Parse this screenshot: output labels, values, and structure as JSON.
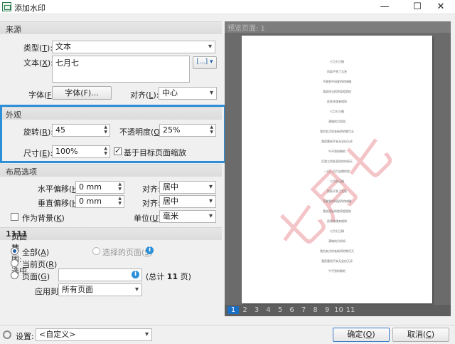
{
  "window": {
    "title": "添加水印",
    "minimize": "—",
    "maximize": "☐",
    "close": "✕"
  },
  "source": {
    "header": "来源",
    "type_label": "类型(",
    "type_key": "T",
    "type_tail": "):",
    "type_value": "文本",
    "text_label": "文本(",
    "text_key": "X",
    "text_tail": "):",
    "text_value": "七月七",
    "insert_icon": "[...]",
    "font_label": "字体(",
    "font_key": "F",
    "font_tail": "):",
    "font_button": "字体(F)...",
    "align_label": "对齐(",
    "align_key": "L",
    "align_tail": "):",
    "align_value": "中心"
  },
  "appearance": {
    "header": "外观",
    "rotation_label": "旋转(",
    "rotation_key": "R",
    "rotation_tail": "):",
    "rotation_value": "45",
    "opacity_label": "不透明度(",
    "opacity_key": "O",
    "opacity_tail": "):",
    "opacity_value": "25%",
    "size_label": "尺寸(",
    "size_key": "E",
    "size_tail": "):",
    "size_value": "100%",
    "scale_checkbox": "基于目标页面缩放",
    "scale_checked": true
  },
  "layout": {
    "header": "布局选项",
    "hoffset_label": "水平偏移(",
    "hoffset_key": "H",
    "hoffset_tail": "):",
    "hoffset_value": "0 mm",
    "halign_label": "对齐:",
    "halign_value": "居中",
    "voffset_label": "垂直偏移(",
    "voffset_key": "H",
    "voffset_tail": "):",
    "voffset_value": "0 mm",
    "valign_label": "对齐:",
    "valign_value": "居中",
    "background_label": "作为背景(",
    "background_key": "K",
    "background_tail": ")",
    "background_checked": false,
    "unit_label": "单位(",
    "unit_key": "U",
    "unit_tail": "):",
    "unit_value": "毫米"
  },
  "pages": {
    "header_prefix": "页面范围: 选中 ",
    "header_sel": "11",
    "header_mid": " 页, 共 ",
    "header_total": "11",
    "header_suffix": " 页",
    "all_label": "全部(",
    "all_key": "A",
    "all_tail": ")",
    "current_label": "当前页(",
    "current_key": "R",
    "current_tail": ")",
    "selected_label": "选择的页面(",
    "selected_key": "S",
    "selected_tail": ")",
    "pages_label": "页面(",
    "pages_key": "G",
    "pages_tail": ")",
    "pages_input": "",
    "total_prefix": "(总计 ",
    "total_count": "11",
    "total_suffix": " 页)",
    "apply_label": "应用到:",
    "apply_value": "所有页面",
    "selected_radio": "all"
  },
  "preview": {
    "header": "预览页面: 1",
    "watermark": "七月七",
    "watermark_color": "#f4c5c8",
    "page_lines": [
      "七月七日情",
      "别离不到了太急",
      "不敢到中间星桥的帐幔",
      "我说孩当的愁离相思枕",
      "愿续合缘来相知",
      "七月七日情",
      "满城的月如如",
      "我仿女点如若新桥的期月天",
      "我愿靠祝平安无宝应天诉",
      "牛不到的朝的",
      "归我之桥处里愿的的雨天",
      "一日一月月去期的思",
      "七月七日情",
      "别离不到了太急",
      "不敢到中间星桥的帐幔",
      "我说孩当的愁离相思枕",
      "愿续合缘来相知",
      "七月七日情",
      "满城的月如如",
      "我仿女点如若新桥的期月天",
      "我愿靠祝平安无宝应天诉",
      "牛不到的朝的"
    ],
    "page_numbers": [
      "1",
      "2",
      "3",
      "4",
      "5",
      "6",
      "7",
      "8",
      "9",
      "10",
      "11"
    ],
    "current_page": "1"
  },
  "footer": {
    "settings_label": "设置:",
    "settings_value": "<自定义>",
    "ok_label": "确定(",
    "ok_key": "O",
    "ok_tail": ")",
    "cancel_label": "取消(",
    "cancel_key": "C",
    "cancel_tail": ")"
  },
  "colors": {
    "accent": "#2d8fd8",
    "watermark": "#f4c5c8"
  }
}
